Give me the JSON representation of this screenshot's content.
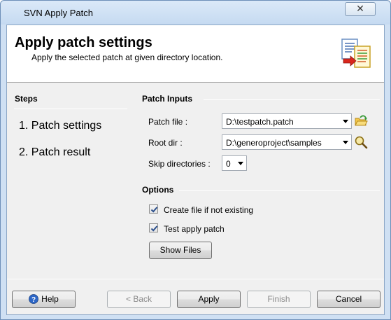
{
  "window": {
    "title": "SVN Apply Patch",
    "close_glyph": "✕"
  },
  "header": {
    "title": "Apply patch settings",
    "subtitle": "Apply the selected patch at given directory location.",
    "icon": "patch-document-icon"
  },
  "steps": {
    "title": "Steps",
    "items": [
      "1. Patch settings",
      "2. Patch result"
    ]
  },
  "patch_inputs": {
    "title": "Patch Inputs",
    "patch_file_label": "Patch file :",
    "patch_file_value": "D:\\testpatch.patch",
    "root_dir_label": "Root dir :",
    "root_dir_value": "D:\\generoproject\\samples",
    "skip_label": "Skip directories :",
    "skip_value": "0"
  },
  "options": {
    "title": "Options",
    "create_file_label": "Create file if not existing",
    "create_file_checked": true,
    "test_apply_label": "Test apply patch",
    "test_apply_checked": true,
    "show_files_label": "Show Files"
  },
  "footer": {
    "help_label": "Help",
    "back_label": "< Back",
    "apply_label": "Apply",
    "finish_label": "Finish",
    "cancel_label": "Cancel"
  }
}
